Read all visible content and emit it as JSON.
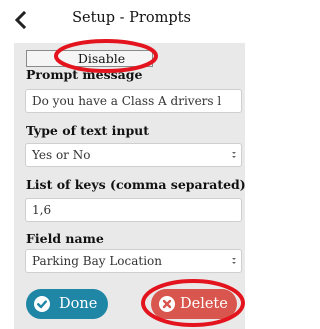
{
  "header": {
    "title": "Setup - Prompts"
  },
  "form": {
    "disable_label": "Disable",
    "prompt_message_label": "Prompt message",
    "prompt_message_value": "Do you have a Class A drivers l",
    "text_input_type_label": "Type of text input",
    "text_input_type_value": "Yes or No",
    "keys_label": "List of keys (comma separated)",
    "keys_value": "1,6",
    "field_name_label": "Field name",
    "field_name_value": "Parking Bay Location"
  },
  "actions": {
    "done_label": "Done",
    "delete_label": "Delete"
  },
  "colors": {
    "done_button": "#1f86a6",
    "delete_button": "#d8564e",
    "annotation_circle": "#e3141e",
    "panel_background": "#e9e9e9"
  },
  "icons": {
    "back": "chevron-left-icon",
    "done": "check-circle-icon",
    "delete": "x-circle-icon"
  }
}
